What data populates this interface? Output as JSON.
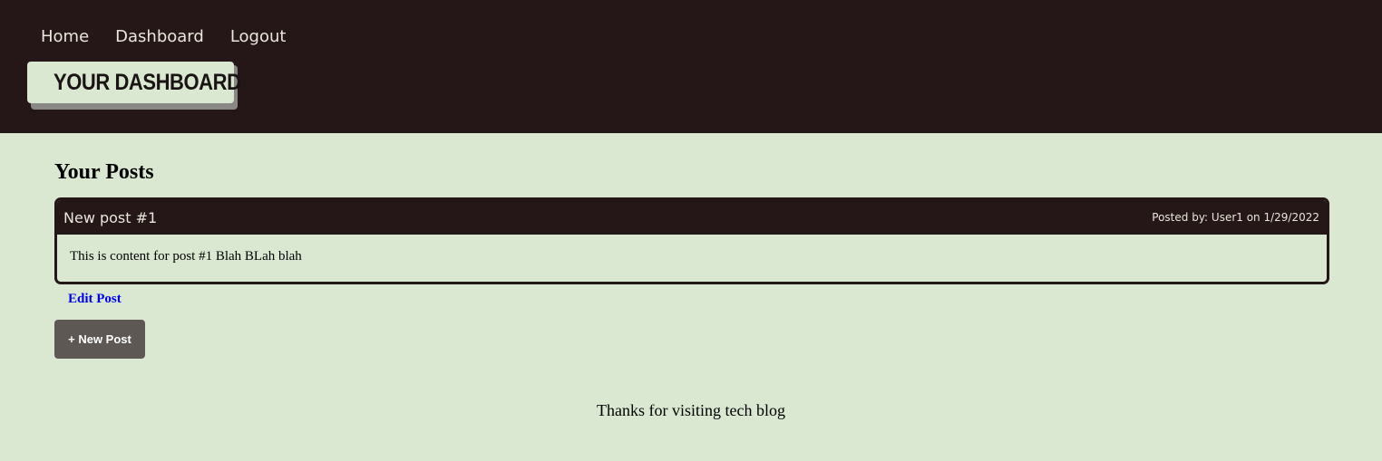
{
  "nav": {
    "items": [
      {
        "label": "Home"
      },
      {
        "label": "Dashboard"
      },
      {
        "label": "Logout"
      }
    ]
  },
  "header": {
    "title": "Your Dashboard"
  },
  "main": {
    "section_title": "Your Posts",
    "posts": [
      {
        "title": "New post #1",
        "meta": "Posted by: User1 on 1/29/2022",
        "content": "This is content for post #1 Blah BLah blah",
        "edit_label": "Edit Post"
      }
    ],
    "new_post_label": "+ New Post"
  },
  "footer": {
    "text": "Thanks for visiting tech blog"
  },
  "colors": {
    "header_bg": "#251617",
    "page_bg": "#dae8d2",
    "button_bg": "#5e5854",
    "link": "#0000ee"
  }
}
